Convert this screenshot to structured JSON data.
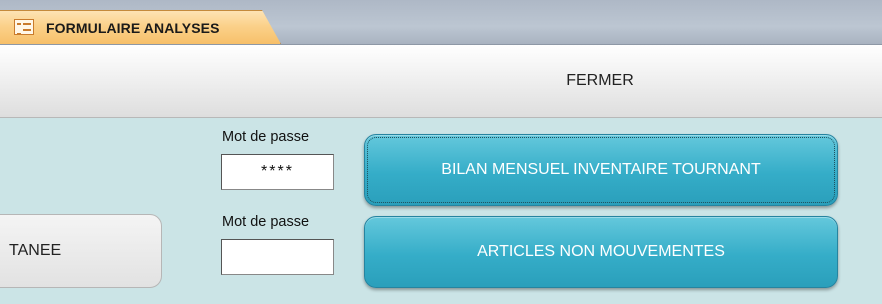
{
  "tab": {
    "label": "FORMULAIRE ANALYSES",
    "icon": "form-icon"
  },
  "header": {
    "close_label": "FERMER"
  },
  "side_button": {
    "label": "TANEE"
  },
  "password1": {
    "label": "Mot de passe",
    "value": "****"
  },
  "password2": {
    "label": "Mot de passe",
    "value": ""
  },
  "buttons": {
    "bilan": "BILAN MENSUEL INVENTAIRE TOURNANT",
    "articles": "ARTICLES NON MOUVEMENTES"
  },
  "colors": {
    "accent_button": "#35adc8",
    "background": "#cbe4e6",
    "tab": "#fbd18a"
  }
}
